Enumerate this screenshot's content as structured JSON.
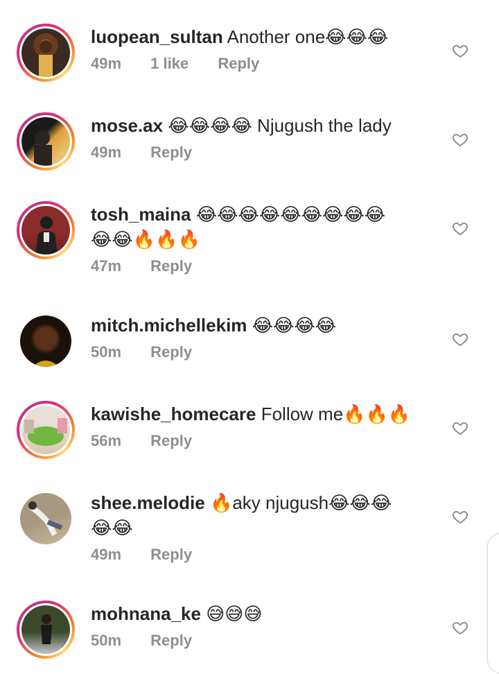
{
  "comments": [
    {
      "username": "luopean_sultan",
      "text": "Another one😂😂😂",
      "text2": "",
      "time": "49m",
      "likes": "1 like",
      "reply": "Reply",
      "avatar_colors": [
        "#6b3b1f",
        "#b38a5c",
        "#3a2a1f"
      ]
    },
    {
      "username": "mose.ax",
      "text": "😂😂😂😂 Njugush the lady",
      "text2": "",
      "time": "49m",
      "likes": "",
      "reply": "Reply",
      "avatar_colors": [
        "#1a1a1a",
        "#e0a040",
        "#f5d890"
      ]
    },
    {
      "username": "tosh_maina",
      "text": "😂😂😂😂😂😂😂😂😂",
      "text2": "😂😂🔥🔥🔥",
      "time": "47m",
      "likes": "",
      "reply": "Reply",
      "avatar_colors": [
        "#8a2a2a",
        "#f0e8e0",
        "#202020"
      ]
    },
    {
      "username": "mitch.michellekim",
      "text": "😂😂😂😂",
      "text2": "",
      "time": "50m",
      "likes": "",
      "reply": "Reply",
      "avatar_colors": [
        "#1a1208",
        "#5a3018",
        "#d8a020"
      ]
    },
    {
      "username": "kawishe_homecare",
      "text": "Follow me🔥🔥🔥",
      "text2": "",
      "time": "56m",
      "likes": "",
      "reply": "Reply",
      "avatar_colors": [
        "#d8c8b0",
        "#70b840",
        "#e8e0d8"
      ]
    },
    {
      "username": "shee.melodie",
      "text": "🔥aky njugush😂😂😂",
      "text2": "😂😂",
      "time": "49m",
      "likes": "",
      "reply": "Reply",
      "avatar_colors": [
        "#a89880",
        "#f0f0ea",
        "#506078"
      ]
    },
    {
      "username": "mohnana_ke",
      "text": "😅😅😅",
      "text2": "",
      "time": "50m",
      "likes": "",
      "reply": "Reply",
      "avatar_colors": [
        "#3a4a2a",
        "#c8c0c8",
        "#1a1a1a"
      ]
    }
  ],
  "colors": {
    "text": "#262626",
    "meta": "#8e8e8e",
    "ring_start": "#f58529",
    "ring_end": "#dd2a7b"
  },
  "icons": {
    "like": "heart-outline-icon"
  }
}
